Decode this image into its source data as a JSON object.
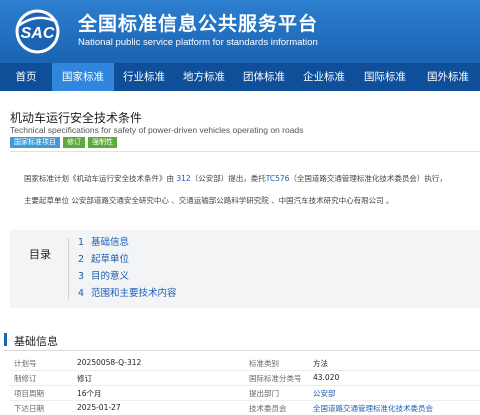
{
  "header": {
    "logo_text": "SAC",
    "title": "全国标准信息公共服务平台",
    "subtitle": "National public service platform  for standards information"
  },
  "nav": {
    "items": [
      {
        "label": "首页",
        "active": false
      },
      {
        "label": "国家标准",
        "active": true
      },
      {
        "label": "行业标准",
        "active": false
      },
      {
        "label": "地方标准",
        "active": false
      },
      {
        "label": "团体标准",
        "active": false
      },
      {
        "label": "企业标准",
        "active": false
      },
      {
        "label": "国际标准",
        "active": false
      },
      {
        "label": "国外标准",
        "active": false
      }
    ]
  },
  "page": {
    "title": "机动车运行安全技术条件",
    "title_en": "Technical specifications for safety of power-driven vehicles operating on roads",
    "tags": [
      "国家标准项目",
      "修订",
      "强制性"
    ]
  },
  "description": {
    "p1_a": "国家标准计划《机动车运行安全技术条件》由 ",
    "p1_link1": "312",
    "p1_b": "（公安部）提出，委托",
    "p1_link2": "TC576",
    "p1_c": "（全国道路交通管理标准化技术委员会）执行，",
    "p2": "主要起草单位 公安部道路交通安全研究中心 、交通运输部公路科学研究院 、中国汽车技术研究中心有限公司 。"
  },
  "toc": {
    "title": "目录",
    "items": [
      {
        "num": "1",
        "label": "基础信息"
      },
      {
        "num": "2",
        "label": "起草单位"
      },
      {
        "num": "3",
        "label": "目的意义"
      },
      {
        "num": "4",
        "label": "范围和主要技术内容"
      }
    ]
  },
  "basic_info": {
    "title": "基础信息",
    "rows": [
      {
        "l1": "计划号",
        "v1": "20250058-Q-312",
        "l2": "标准类别",
        "v2": "方法"
      },
      {
        "l1": "制修订",
        "v1": "修订",
        "l2": "国际标准分类号",
        "v2": "43.020"
      },
      {
        "l1": "项目周期",
        "v1": "16个月",
        "l2": "提出部门",
        "v2": "公安部"
      },
      {
        "l1": "下达日期",
        "v1": "2025-01-27",
        "l2": "技术委员会",
        "v2": "全国道路交通管理标准化技术委员会"
      }
    ]
  },
  "colors": {
    "header_blue": "#1b63b3",
    "nav_dark": "#0f4f9a",
    "nav_active": "#2f86dc",
    "link": "#1a5fb4"
  }
}
